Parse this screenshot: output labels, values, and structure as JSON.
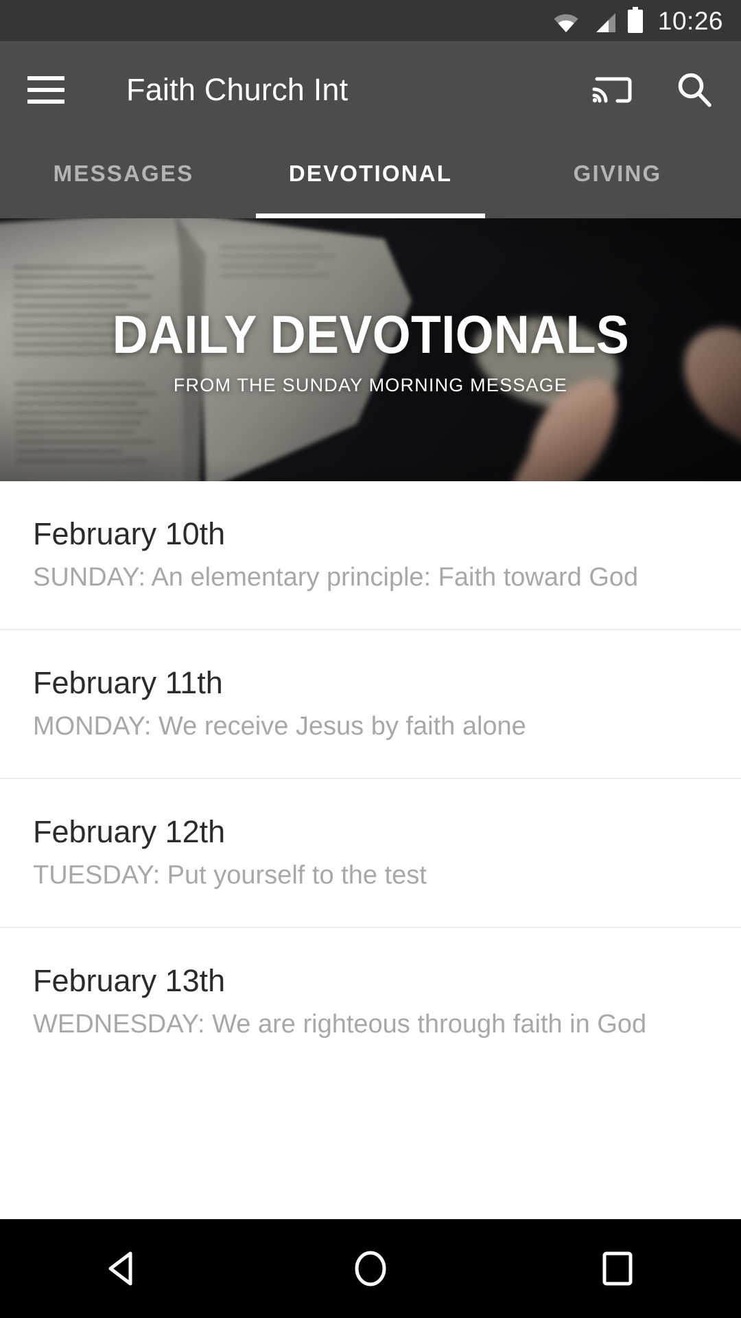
{
  "status_bar": {
    "time": "10:26",
    "icons": [
      "wifi-icon",
      "cellular-signal-icon",
      "battery-icon"
    ],
    "background_color": "#373535"
  },
  "app_bar": {
    "menu_icon": "hamburger-menu-icon",
    "title": "Faith Church Int",
    "cast_icon": "cast-icon",
    "search_icon": "search-icon",
    "background_color": "#4e4b4b"
  },
  "tabs": {
    "items": [
      {
        "label": "MESSAGES",
        "active": false
      },
      {
        "label": "DEVOTIONAL",
        "active": true
      },
      {
        "label": "GIVING",
        "active": false
      }
    ],
    "indicator_color": "#ffffff",
    "active_color": "#ffffff",
    "inactive_color": "#b6b3b3"
  },
  "hero": {
    "title": "DAILY DEVOTIONALS",
    "subtitle": "FROM THE SUNDAY MORNING MESSAGE",
    "image_description": "hands-holding-open-bible-photo"
  },
  "list": {
    "items": [
      {
        "title": "February 10th",
        "subtitle": "SUNDAY: An elementary principle: Faith toward God"
      },
      {
        "title": "February 11th",
        "subtitle": "MONDAY: We receive Jesus by faith alone"
      },
      {
        "title": "February 12th",
        "subtitle": "TUESDAY: Put yourself to the test"
      },
      {
        "title": "February 13th",
        "subtitle": "WEDNESDAY: We are righteous through faith in God"
      }
    ],
    "title_color": "#2b2b2b",
    "subtitle_color": "#a8a8a8",
    "divider_color": "#ebebeb"
  },
  "nav_bar": {
    "buttons": [
      {
        "name": "back-button",
        "icon": "back-triangle-icon"
      },
      {
        "name": "home-button",
        "icon": "home-circle-icon"
      },
      {
        "name": "recents-button",
        "icon": "recents-square-icon"
      }
    ],
    "background_color": "#000000"
  }
}
